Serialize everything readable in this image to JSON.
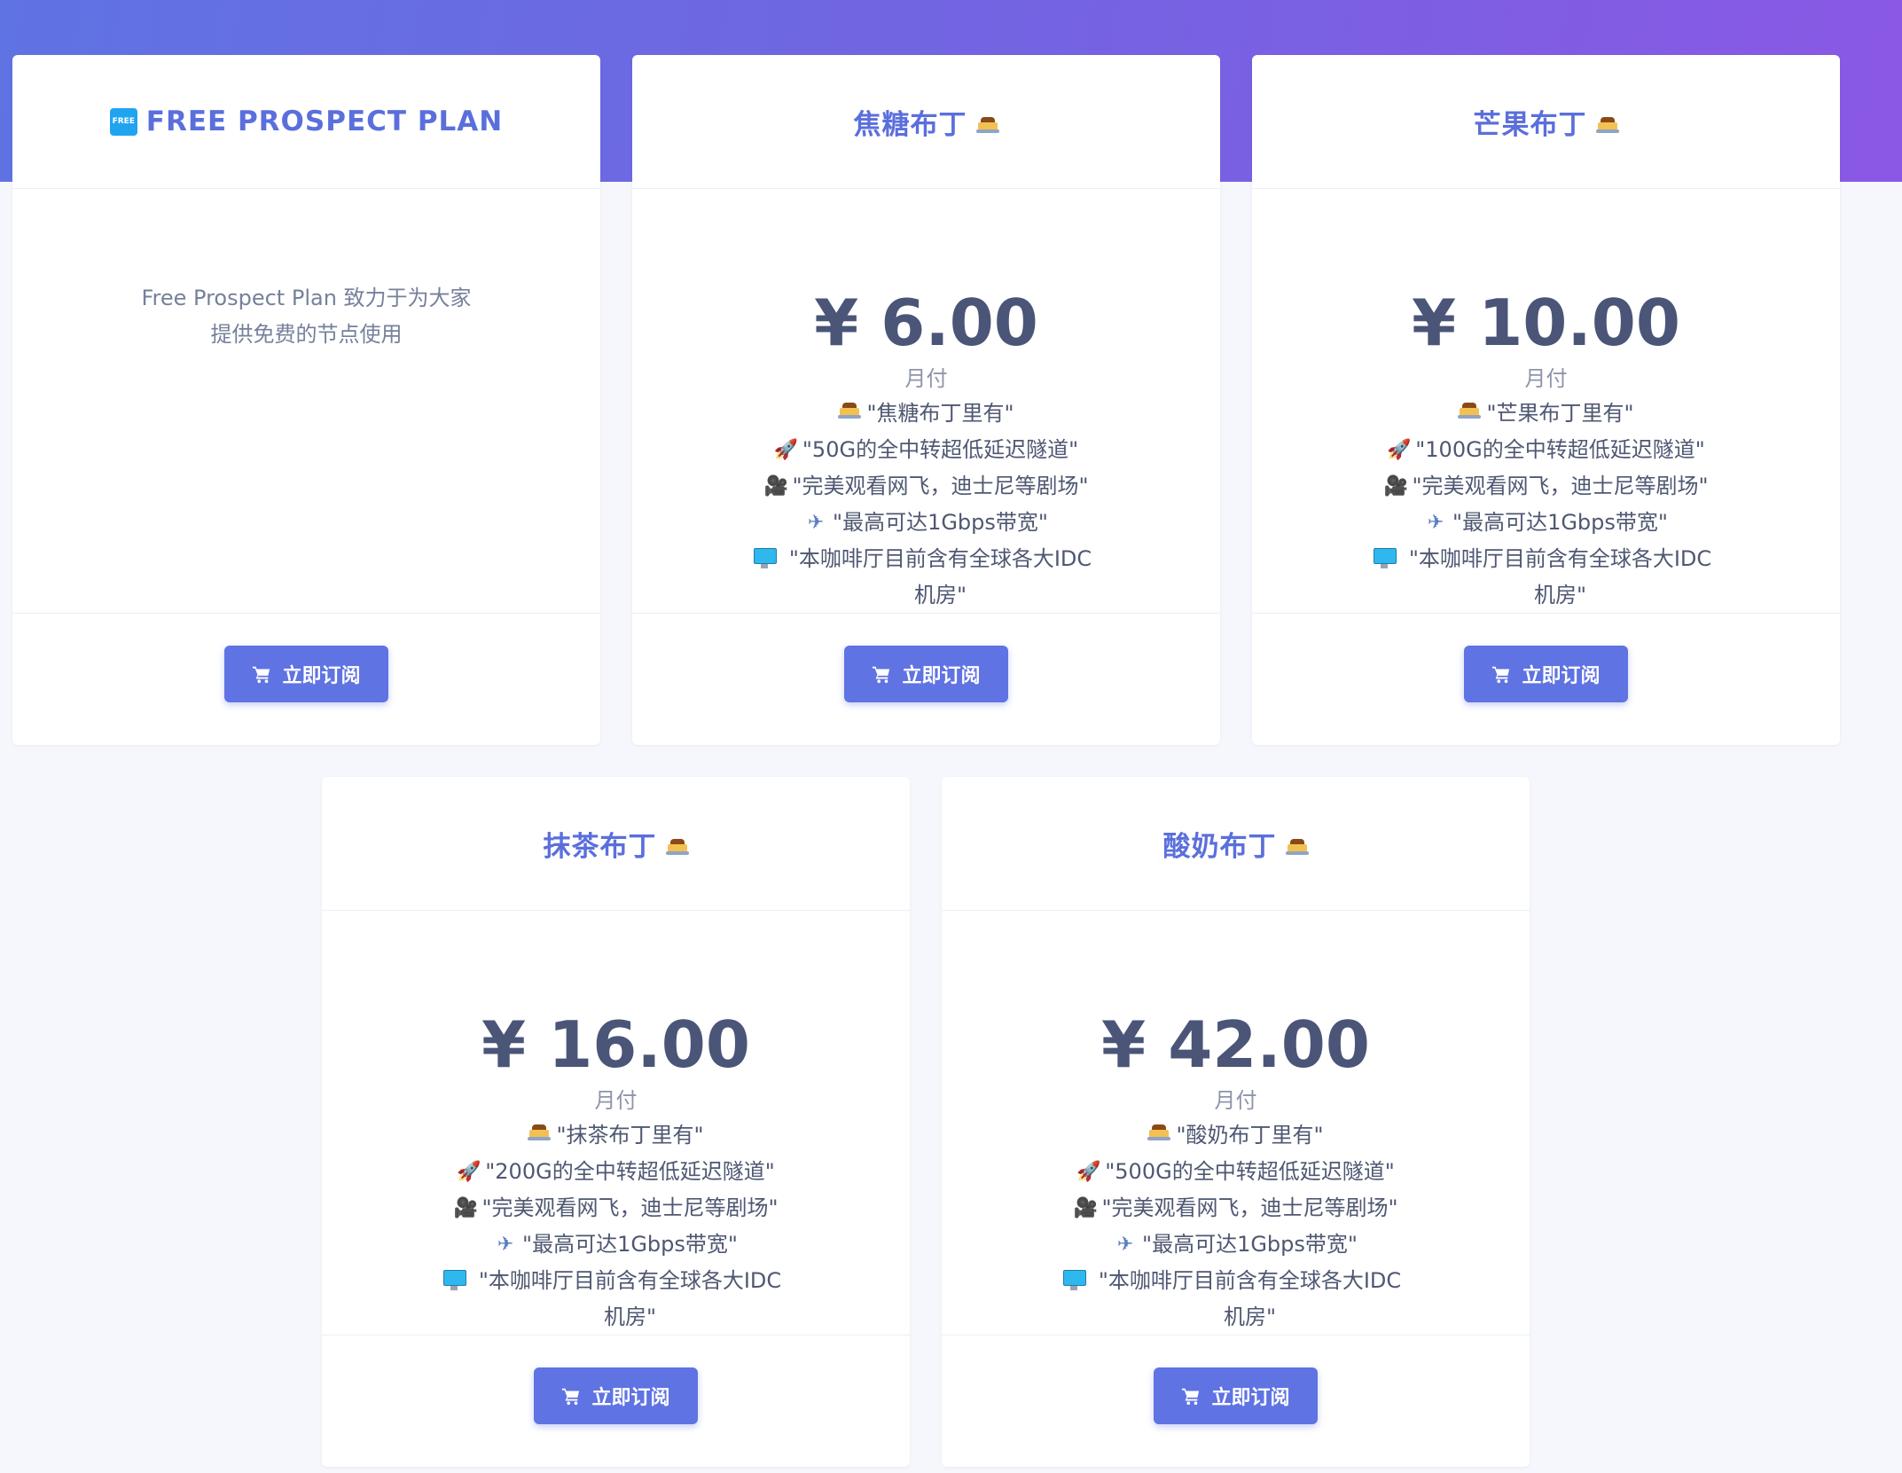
{
  "plans": [
    {
      "title": "FREE PROSPECT PLAN",
      "badge": "FREE",
      "description_lines": [
        "Free Prospect Plan 致力于为大家",
        "提供免费的节点使用"
      ],
      "subscribe_label": "立即订阅"
    },
    {
      "title": "焦糖布丁",
      "price": "¥ 6.00",
      "period": "月付",
      "features": {
        "included": "\"焦糖布丁里有\"",
        "tunnel": "\"50G的全中转超低延迟隧道\"",
        "streaming": "\"完美观看网飞，迪士尼等剧场\"",
        "bandwidth": "\"最高可达1Gbps带宽\"",
        "idc": "\"本咖啡厅目前含有全球各大IDC 机房\""
      },
      "subscribe_label": "立即订阅"
    },
    {
      "title": "芒果布丁",
      "price": "¥ 10.00",
      "period": "月付",
      "features": {
        "included": "\"芒果布丁里有\"",
        "tunnel": "\"100G的全中转超低延迟隧道\"",
        "streaming": "\"完美观看网飞，迪士尼等剧场\"",
        "bandwidth": "\"最高可达1Gbps带宽\"",
        "idc": "\"本咖啡厅目前含有全球各大IDC 机房\""
      },
      "subscribe_label": "立即订阅"
    },
    {
      "title": "抹茶布丁",
      "price": "¥ 16.00",
      "period": "月付",
      "features": {
        "included": "\"抹茶布丁里有\"",
        "tunnel": "\"200G的全中转超低延迟隧道\"",
        "streaming": "\"完美观看网飞，迪士尼等剧场\"",
        "bandwidth": "\"最高可达1Gbps带宽\"",
        "idc": "\"本咖啡厅目前含有全球各大IDC 机房\""
      },
      "subscribe_label": "立即订阅"
    },
    {
      "title": "酸奶布丁",
      "price": "¥ 42.00",
      "period": "月付",
      "features": {
        "included": "\"酸奶布丁里有\"",
        "tunnel": "\"500G的全中转超低延迟隧道\"",
        "streaming": "\"完美观看网飞，迪士尼等剧场\"",
        "bandwidth": "\"最高可达1Gbps带宽\"",
        "idc": "\"本咖啡厅目前含有全球各大IDC 机房\""
      },
      "subscribe_label": "立即订阅"
    }
  ],
  "icons": {
    "title_suffix": "pudding-icon",
    "free_badge": "free-badge-icon",
    "included": "pudding-icon",
    "tunnel": "rocket-icon",
    "streaming": "movie-camera-icon",
    "bandwidth": "airplane-icon",
    "idc": "desktop-monitor-icon",
    "button": "cart-icon"
  },
  "colors": {
    "accent": "#5f73e3",
    "title": "#5b6fdc",
    "price": "#4a5578",
    "hero_gradient_start": "#5f73e3",
    "hero_gradient_end": "#8a58e4",
    "page_background": "#f5f7fc"
  }
}
